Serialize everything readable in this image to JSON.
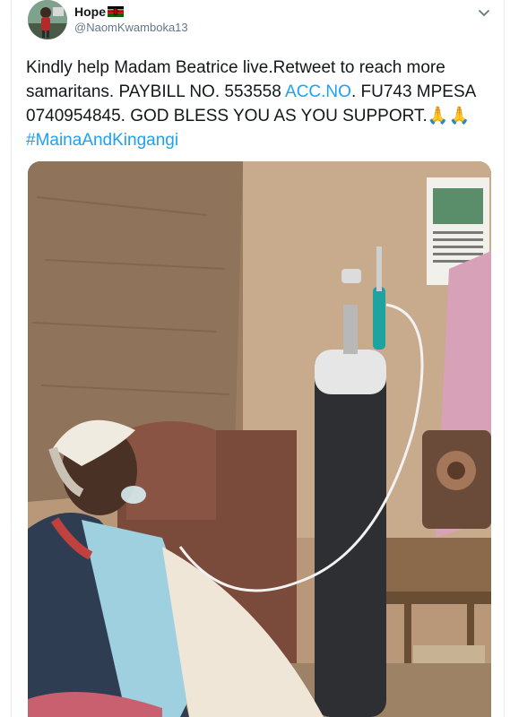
{
  "user": {
    "display_name": "Hope",
    "handle": "@NaomKwamboka13",
    "flag_icon": "kenya-flag-icon"
  },
  "tweet": {
    "text_1": "Kindly help Madam Beatrice live.Retweet to reach more samaritans. PAYBILL NO. 553558 ",
    "link_accno": "ACC.NO",
    "text_2": ". FU743 MPESA 0740954845. GOD BLESS YOU AS YOU SUPPORT.",
    "emoji": "🙏🙏",
    "hashtag": "#MainaAndKingangi"
  },
  "colors": {
    "link": "#1da1f2",
    "handle": "#657786"
  }
}
